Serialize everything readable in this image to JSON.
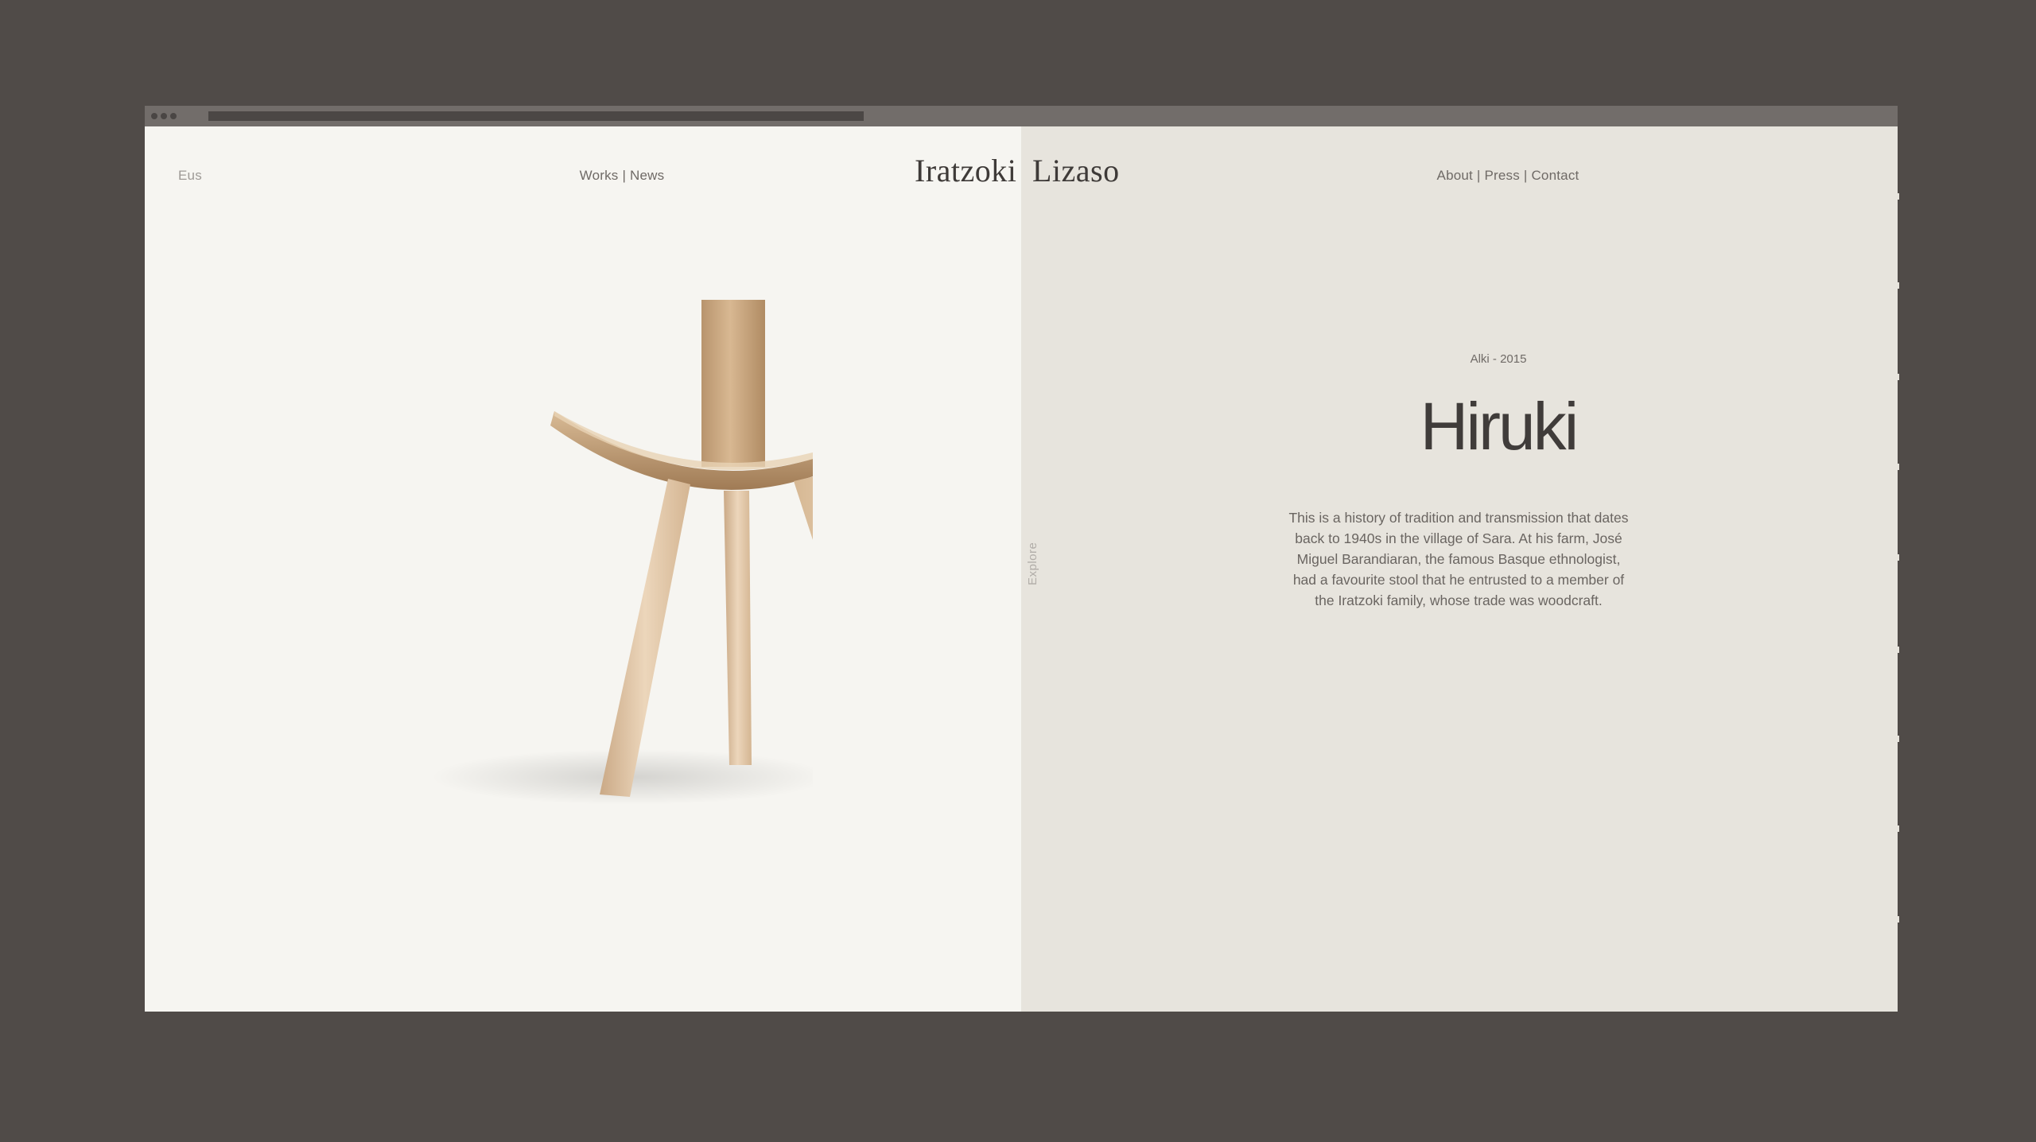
{
  "header": {
    "language": "Eus",
    "nav_left": {
      "works": "Works",
      "news": "News",
      "separator": "|"
    },
    "logo": {
      "left_word": "Iratzoki",
      "right_word": "Lizaso"
    },
    "nav_right": {
      "about": "About",
      "press": "Press",
      "contact": "Contact",
      "separator": "|"
    }
  },
  "side_label": "Explore",
  "product": {
    "meta": "Alki - 2015",
    "title": "Hiruki",
    "description": "This is a history of tradition and transmission that dates back to 1940s in the village of Sara. At his farm, José Miguel Barandiaran, the famous Basque ethnologist, had a favourite stool that he entrusted to a member of the Iratzoki family, whose trade was woodcraft."
  },
  "colors": {
    "outer_background": "#504b48",
    "left_pane": "#f6f5f1",
    "right_pane": "#e7e4dd",
    "wood_light": "#e8cfb0",
    "wood_mid": "#c9a983",
    "wood_dark": "#a8865f",
    "text_dark": "#403c3a"
  }
}
